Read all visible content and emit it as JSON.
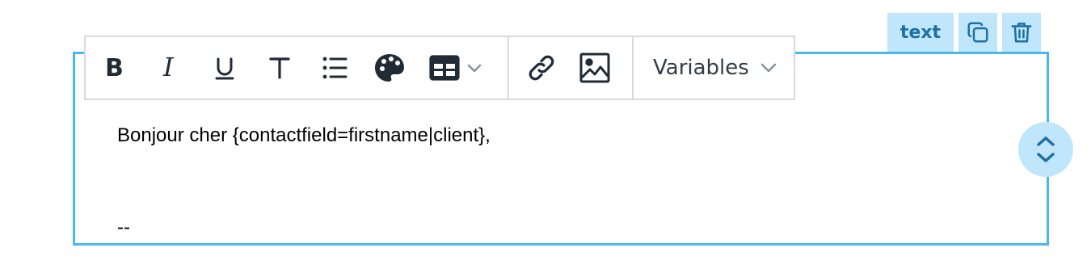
{
  "block": {
    "type_label": "text",
    "duplicate_icon": "copy-icon",
    "delete_icon": "trash-icon"
  },
  "toolbar": {
    "buttons": [
      {
        "name": "bold",
        "icon": "bold-icon",
        "glyph": "B"
      },
      {
        "name": "italic",
        "icon": "italic-icon",
        "glyph": "I"
      },
      {
        "name": "underline",
        "icon": "underline-icon",
        "glyph": "U"
      },
      {
        "name": "text-style",
        "icon": "text-icon",
        "glyph": "T"
      },
      {
        "name": "bulleted-list",
        "icon": "list-icon"
      },
      {
        "name": "color",
        "icon": "palette-icon"
      },
      {
        "name": "table",
        "icon": "table-icon"
      },
      {
        "name": "link",
        "icon": "link-icon"
      },
      {
        "name": "image",
        "icon": "image-icon"
      }
    ],
    "variables_label": "Variables"
  },
  "content": {
    "line1": "Bonjour cher {contactfield=firstname|client},",
    "signature_separator": "--"
  },
  "colors": {
    "frame_border": "#4bb8ec",
    "accent_bg": "#bfe6fb",
    "accent_fg": "#1d6fa5",
    "toolbar_border": "#d9d9d9",
    "icon": "#212b36"
  }
}
